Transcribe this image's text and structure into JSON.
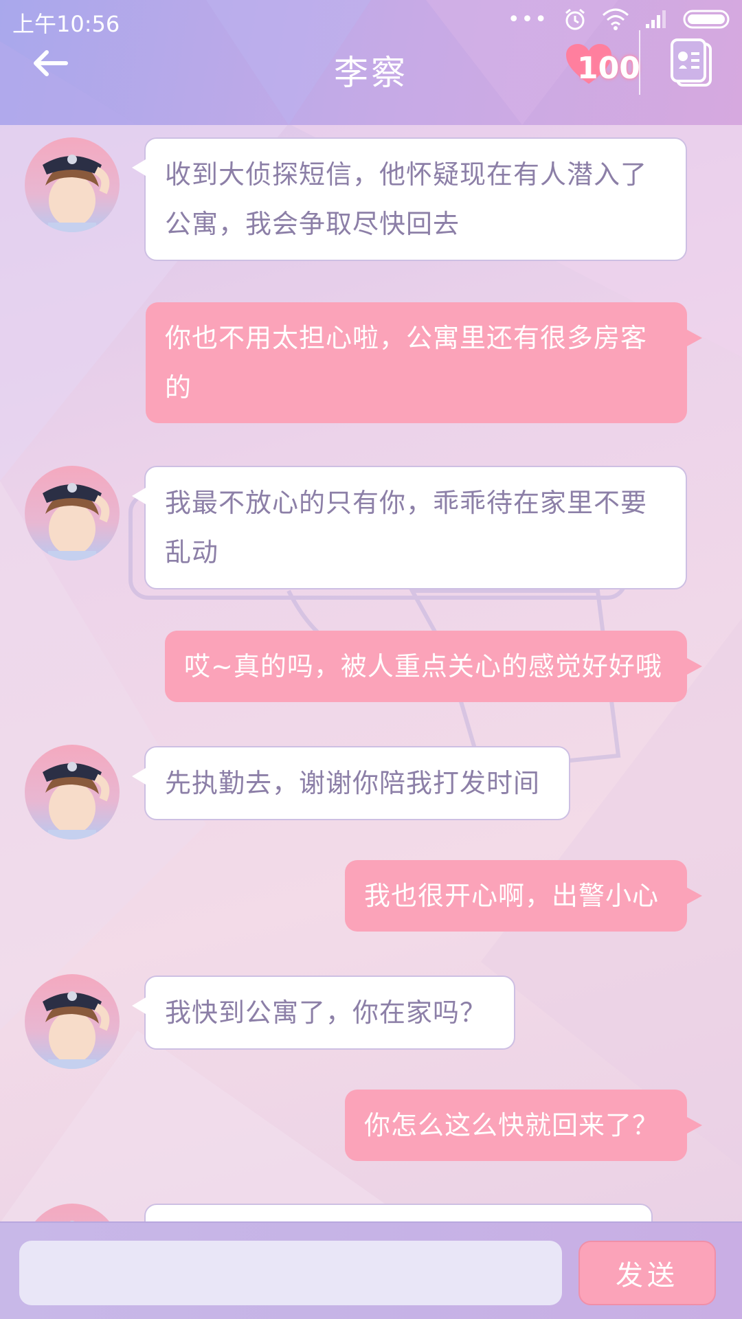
{
  "status_bar": {
    "time": "上午10:56"
  },
  "header": {
    "title": "李察",
    "heart_count": "100"
  },
  "messages": [
    {
      "from": "contact",
      "text": "收到大侦探短信，他怀疑现在有人潜入了公寓，我会争取尽快回去"
    },
    {
      "from": "me",
      "text": "你也不用太担心啦，公寓里还有很多房客的"
    },
    {
      "from": "contact",
      "text": "我最不放心的只有你，乖乖待在家里不要乱动"
    },
    {
      "from": "me",
      "text": "哎~真的吗，被人重点关心的感觉好好哦"
    },
    {
      "from": "contact",
      "text": "先执勤去，谢谢你陪我打发时间"
    },
    {
      "from": "me",
      "text": "我也很开心啊，出警小心"
    },
    {
      "from": "contact",
      "text": "我快到公寓了，你在家吗？"
    },
    {
      "from": "me",
      "text": "你怎么这么快就回来了？"
    },
    {
      "from": "contact",
      "text": ""
    }
  ],
  "composer": {
    "input_value": "",
    "send_label": "发送"
  },
  "colors": {
    "outgoing_bubble": "#fba3b9",
    "incoming_text": "#8c7fa7",
    "header_gradient_start": "#a9a8ec"
  }
}
